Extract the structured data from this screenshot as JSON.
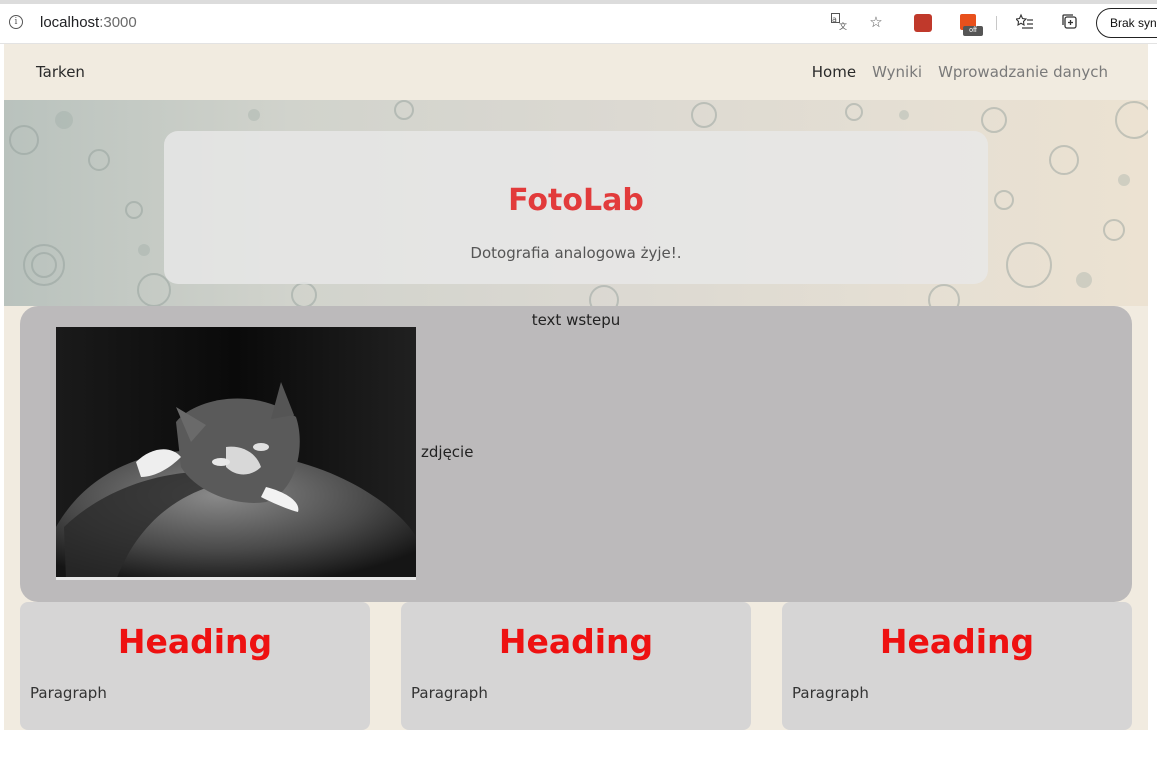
{
  "browser": {
    "url_host": "localhost",
    "url_port": ":3000",
    "sync_label": "Brak synch"
  },
  "navbar": {
    "brand": "Tarken",
    "links": [
      {
        "label": "Home",
        "active": true
      },
      {
        "label": "Wyniki",
        "active": false
      },
      {
        "label": "Wprowadzanie danych",
        "active": false
      }
    ]
  },
  "hero": {
    "title": "FotoLab",
    "subtitle": "Dotografia analogowa żyje!."
  },
  "intro": {
    "text": "text wstepu",
    "image_caption": "zdjęcie"
  },
  "cards": [
    {
      "heading": "Heading",
      "paragraph": "Paragraph"
    },
    {
      "heading": "Heading",
      "paragraph": "Paragraph"
    },
    {
      "heading": "Heading",
      "paragraph": "Paragraph"
    }
  ],
  "colors": {
    "page_bg": "#f1ebe0",
    "accent_red": "#e23b3b",
    "heading_red": "#ee1111",
    "intro_bg": "#bcbabb",
    "card_bg": "#d6d5d5"
  }
}
